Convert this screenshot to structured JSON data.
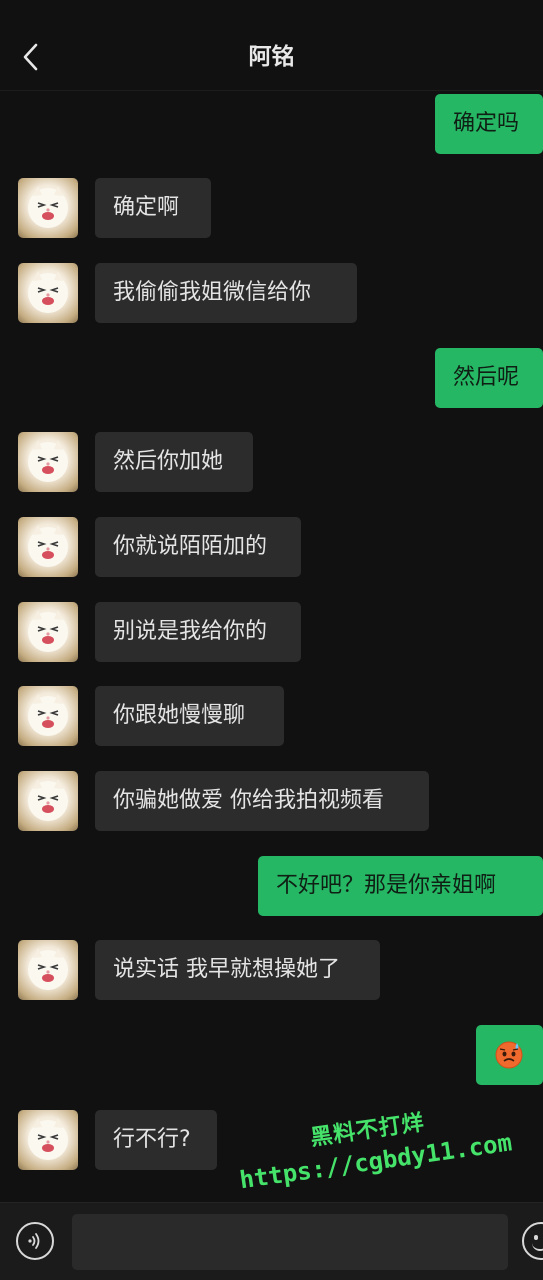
{
  "header": {
    "title": "阿铭",
    "back_icon": "chevron-left-icon"
  },
  "messages": [
    {
      "side": "right",
      "text": "确定吗"
    },
    {
      "side": "left",
      "text": "确定啊"
    },
    {
      "side": "left",
      "text": "我偷偷我姐微信给你"
    },
    {
      "side": "right",
      "text": "然后呢"
    },
    {
      "side": "left",
      "text": "然后你加她"
    },
    {
      "side": "left",
      "text": "你就说陌陌加的"
    },
    {
      "side": "left",
      "text": "别说是我给你的"
    },
    {
      "side": "left",
      "text": "你跟她慢慢聊"
    },
    {
      "side": "left",
      "text": "你骗她做爱 你给我拍视频看"
    },
    {
      "side": "right",
      "text": "不好吧？那是你亲姐啊"
    },
    {
      "side": "left",
      "text": "说实话 我早就想操她了"
    },
    {
      "side": "right",
      "text": "",
      "emoji": "sweating-face-emoji"
    },
    {
      "side": "left",
      "text": "行不行?"
    }
  ],
  "watermark": {
    "line1": "黑料不打烊",
    "line2": "https://cgbdy11.com"
  },
  "input_bar": {
    "voice_icon": "voice-icon",
    "input_value": "",
    "emoji_icon": "emoji-icon"
  },
  "colors": {
    "background": "#111111",
    "own_bubble": "#26b765",
    "other_bubble": "#2c2c2c",
    "watermark": "#46e36b"
  }
}
